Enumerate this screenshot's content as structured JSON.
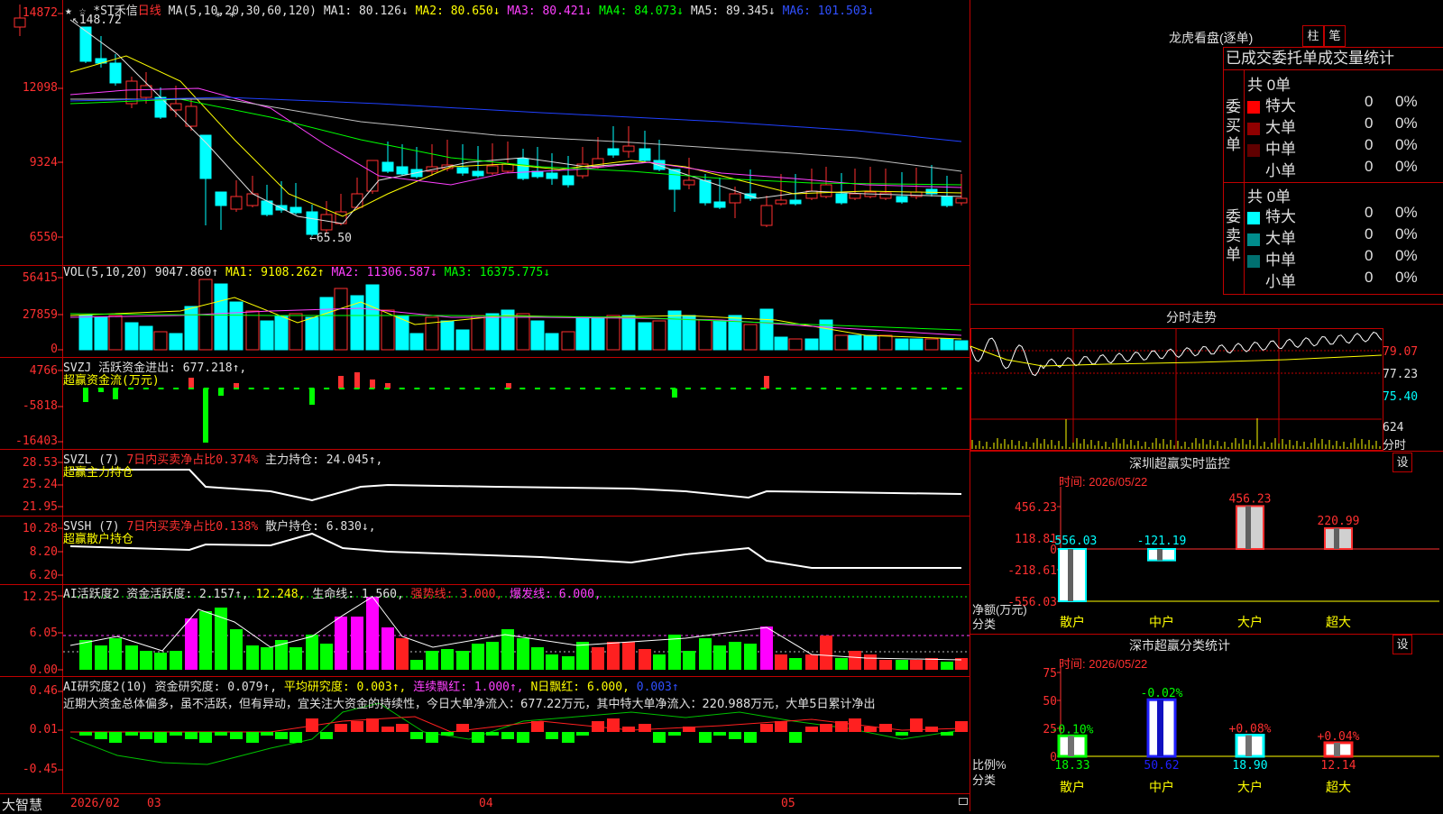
{
  "candle": {
    "star_icons": "★ ☆",
    "stock_name": "*ST禾信",
    "period": "日线",
    "ma_label": "MA(5,10,20,30,60,120)",
    "ma1": "MA1: 80.126↓",
    "ma2": "MA2: 80.650↓",
    "ma3": "MA3: 80.421↓",
    "ma4": "MA4: 84.073↓",
    "ma5": "MA5: 89.345↓",
    "ma6": "MA6: 101.503↓",
    "high_mark": "148.72",
    "low_mark": "65.50",
    "yticks": [
      "14872",
      "12098",
      "9324",
      "6550"
    ],
    "indicator_marks": "* *"
  },
  "vol": {
    "label": "VOL(5,10,20)",
    "value": "9047.860↑",
    "ma1": "MA1: 9108.262↑",
    "ma2": "MA2: 11306.587↓",
    "ma3": "MA3: 16375.775↓",
    "yticks": [
      "56415",
      "27859",
      "0"
    ]
  },
  "svzj": {
    "label": "SVZJ",
    "text1": "活跃资金进出: 677.218↑,",
    "text2": "超赢资金流(万元)",
    "yticks": [
      "4766",
      "-5818",
      "-16403"
    ]
  },
  "svzl": {
    "label": "SVZL (7)",
    "text1": "7日内买卖净占比0.374%",
    "text2": "主力持仓: 24.045↑,",
    "text3": "超赢主力持仓",
    "yticks": [
      "28.53",
      "25.24",
      "21.95"
    ]
  },
  "svsh": {
    "label": "SVSH (7)",
    "text1": "7日内买卖净占比0.138%",
    "text2": "散户持仓: 6.830↓,",
    "text3": "超赢散户持仓",
    "yticks": [
      "10.28",
      "8.20",
      "6.20"
    ]
  },
  "ai1": {
    "label": "AI活跃度2",
    "text1": "资金活跃度: 2.157↑,",
    "text2": "12.248,",
    "text3": "生命线: 1.560,",
    "text4": "强势线: 3.000,",
    "text5": "爆发线: 6.000,",
    "yticks": [
      "12.25",
      "6.05",
      "0.00"
    ]
  },
  "ai2": {
    "label": "AI研究度2(10)",
    "text1": "资金研究度: 0.079↑,",
    "text2": "平均研究度: 0.003↑,",
    "text3": "连续飘红: 1.000↑,",
    "text4": "N日飘红: 6.000,",
    "text5": "0.003↑",
    "comment": "近期大资金总体偏多，虽不活跃，但有异动，宜关注大资金的持续性，今日大单净流入：677.22万元，其中特大单净流入：220.988万元，大单5日累计净出",
    "yticks": [
      "0.46",
      "0.01",
      "-0.45"
    ]
  },
  "bottom": {
    "brand": "大智慧",
    "dates": [
      "2026/02",
      "03",
      "04",
      "05"
    ]
  },
  "dragon": {
    "title": "龙虎看盘(逐单)",
    "btn1": "柱",
    "btn2": "笔",
    "subtitle": "已成交委托单成交量统计",
    "buy_side": "委买单",
    "sell_side": "委卖单",
    "buy_total": "共 0单",
    "sell_total": "共 0单",
    "rows": [
      "特大",
      "大单",
      "中单",
      "小单"
    ],
    "count": "0",
    "pct": "0%",
    "colors_buy": [
      "#ff0000",
      "#900000",
      "#600000",
      "#000000"
    ],
    "colors_sell": [
      "#00ffff",
      "#008c8c",
      "#007070",
      "#000000"
    ]
  },
  "intraday": {
    "title": "分时走势",
    "yticks": [
      "79.07",
      "77.23",
      "75.40"
    ],
    "vol_tick": "624",
    "vol_label": "分时"
  },
  "monitor": {
    "title": "深圳超赢实时监控",
    "btn": "设",
    "time": "时间: 2026/05/22",
    "yticks": [
      "456.23",
      "118.81",
      "0",
      "-218.61",
      "-556.03"
    ],
    "ylabel1": "净额(万元)",
    "ylabel2": "分类",
    "bars": [
      {
        "name": "散户",
        "value": "-556.03"
      },
      {
        "name": "中户",
        "value": "-121.19"
      },
      {
        "name": "大户",
        "value": "456.23"
      },
      {
        "name": "超大",
        "value": "220.99"
      }
    ]
  },
  "stats": {
    "title": "深市超赢分类统计",
    "btn": "设",
    "time": "时间: 2026/05/22",
    "yticks": [
      "75",
      "50",
      "25",
      "0"
    ],
    "ylabel1": "比例%",
    "ylabel2": "分类",
    "bars": [
      {
        "name": "散户",
        "value": "18.33",
        "change": "-0.10%"
      },
      {
        "name": "中户",
        "value": "50.62",
        "change": "-0.02%"
      },
      {
        "name": "大户",
        "value": "18.90",
        "change": "+0.08%"
      },
      {
        "name": "超大",
        "value": "12.14",
        "change": "+0.04%"
      }
    ]
  }
}
